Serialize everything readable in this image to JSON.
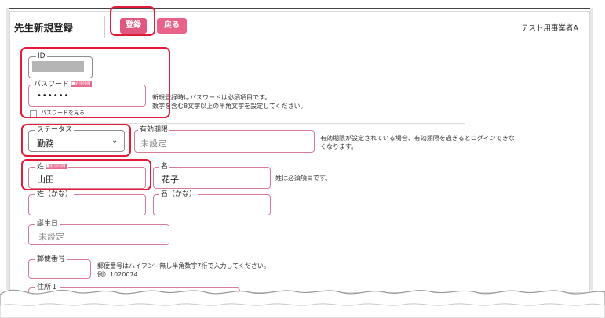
{
  "header": {
    "title": "先生新規登録",
    "register_label": "登録",
    "back_label": "戻る",
    "org_name": "テスト用事業者A"
  },
  "form": {
    "id": {
      "label": "ID"
    },
    "password": {
      "label": "パスワード",
      "required_badge": "■必須項目",
      "value": "••••••",
      "help": "新規登録時はパスワードは必須項目です。\n数字を含む8文字以上の半角文字を設定してください。",
      "show_label": "パスワードを見る"
    },
    "status": {
      "label": "ステータス",
      "selected": "勤務"
    },
    "expiry": {
      "label": "有効期限",
      "placeholder": "未設定",
      "help": "有効期限が設定されている場合、有効期限を過ぎるとログインできな\nくなります。"
    },
    "last_name": {
      "label": "姓",
      "required_badge": "■必須項目",
      "value": "山田",
      "help": "姓は必須項目です。"
    },
    "first_name": {
      "label": "名",
      "value": "花子"
    },
    "last_name_kana": {
      "label": "姓（かな）"
    },
    "first_name_kana": {
      "label": "名（かな）"
    },
    "birthday": {
      "label": "誕生日",
      "placeholder": "未設定"
    },
    "postal_code": {
      "label": "郵便番号",
      "help": "郵便番号はハイフン'-'無し半角数字7桁で入力してください。\n例）1020074"
    },
    "address1": {
      "label": "住所１"
    }
  },
  "colors": {
    "accent": "#e0577f",
    "highlight": "#e21c38",
    "field_border": "#d97b96"
  }
}
